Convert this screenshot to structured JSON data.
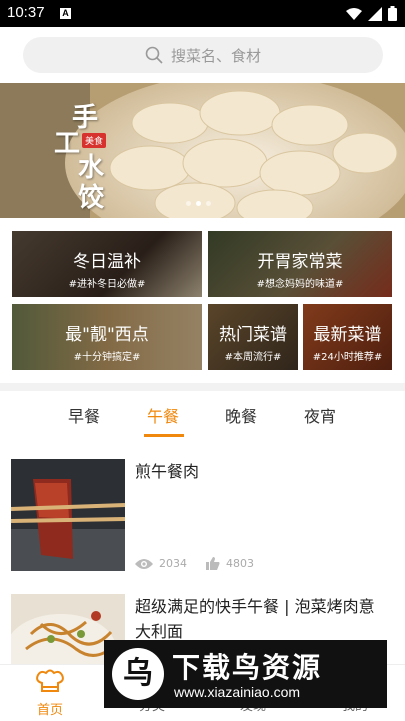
{
  "status": {
    "time": "10:37",
    "app_icon": "A"
  },
  "search": {
    "placeholder": "搜菜名、食材"
  },
  "banner": {
    "chars": [
      "手",
      "工",
      "水",
      "饺"
    ],
    "tag": "美食",
    "slide_index": 1,
    "slide_count": 3
  },
  "categories": [
    {
      "title": "冬日温补",
      "subtitle": "#进补冬日必做#"
    },
    {
      "title": "开胃家常菜",
      "subtitle": "#想念妈妈的味道#"
    },
    {
      "title": "最\"靓\"西点",
      "subtitle": "#十分钟搞定#"
    },
    {
      "title": "热门菜谱",
      "subtitle": "#本周流行#"
    },
    {
      "title": "最新菜谱",
      "subtitle": "#24小时推荐#"
    }
  ],
  "meal_tabs": [
    "早餐",
    "午餐",
    "晚餐",
    "夜宵"
  ],
  "active_tab": "午餐",
  "recipes": [
    {
      "title": "煎午餐肉",
      "views": "2034",
      "likes": "4803"
    },
    {
      "title": "超级满足的快手午餐 | 泡菜烤肉意大利面"
    }
  ],
  "bottom_nav": [
    {
      "label": "首页",
      "active": true
    },
    {
      "label": "分类"
    },
    {
      "label": "发现"
    },
    {
      "label": "我的"
    }
  ],
  "watermark": {
    "logo": "乌",
    "title": "下载鸟资源",
    "url": "www.xiazainiao.com"
  },
  "colors": {
    "accent": "#f0880d",
    "statusbar": "#000000",
    "search_bg": "#f0f0f0"
  }
}
